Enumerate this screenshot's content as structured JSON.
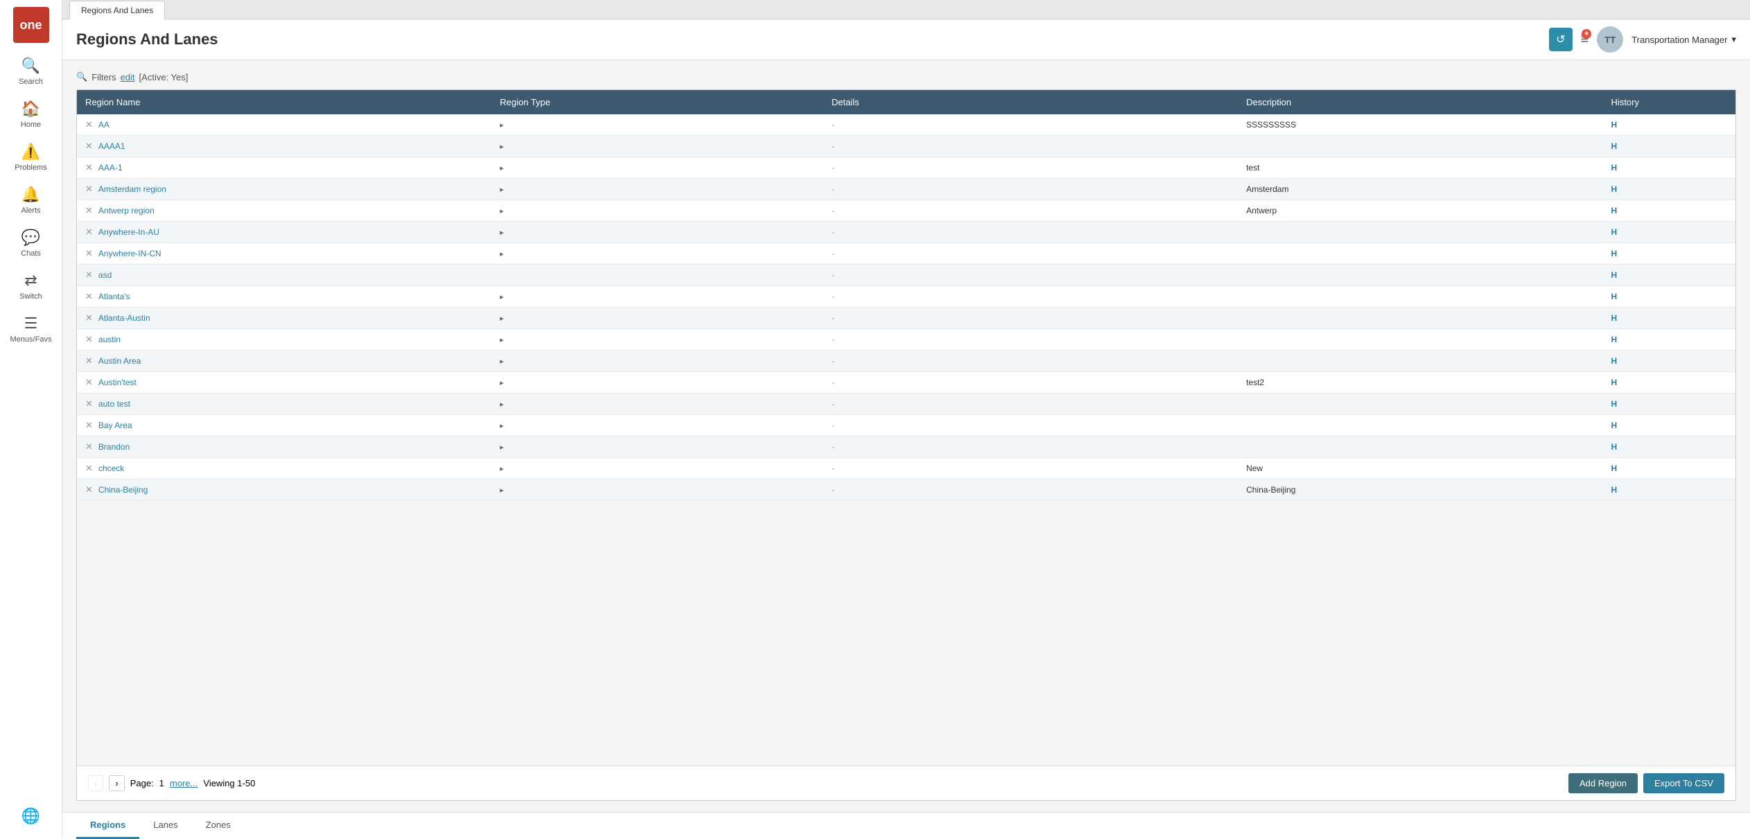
{
  "app": {
    "logo": "one",
    "tab": "Regions And Lanes"
  },
  "sidebar": {
    "items": [
      {
        "id": "search",
        "label": "Search",
        "icon": "🔍"
      },
      {
        "id": "home",
        "label": "Home",
        "icon": "🏠"
      },
      {
        "id": "problems",
        "label": "Problems",
        "icon": "⚠️"
      },
      {
        "id": "alerts",
        "label": "Alerts",
        "icon": "🔔"
      },
      {
        "id": "chats",
        "label": "Chats",
        "icon": "💬"
      },
      {
        "id": "switch",
        "label": "Switch",
        "icon": "⇄"
      },
      {
        "id": "menus-favs",
        "label": "Menus/Favs",
        "icon": "☰"
      }
    ],
    "globe_icon": "🌐"
  },
  "header": {
    "title": "Regions And Lanes",
    "refresh_icon": "↺",
    "menu_icon": "≡",
    "notification_count": "★",
    "avatar_initials": "TT",
    "user_role": "Transportation Manager",
    "dropdown_arrow": "▾"
  },
  "filters": {
    "label": "Filters",
    "edit_label": "edit",
    "active_filter": "[Active: Yes]"
  },
  "table": {
    "columns": [
      "Region Name",
      "Region Type",
      "Details",
      "Description",
      "History"
    ],
    "rows": [
      {
        "name": "AA",
        "type": "▸",
        "details": "-",
        "description": "SSSSSSSSS",
        "history": "H"
      },
      {
        "name": "AAAA1",
        "type": "▸",
        "details": "-",
        "description": "",
        "history": "H"
      },
      {
        "name": "AAA-1",
        "type": "▸",
        "details": "-",
        "description": "test",
        "history": "H"
      },
      {
        "name": "Amsterdam region",
        "type": "▸",
        "details": "-",
        "description": "Amsterdam",
        "history": "H"
      },
      {
        "name": "Antwerp region",
        "type": "▸",
        "details": "-",
        "description": "Antwerp",
        "history": "H"
      },
      {
        "name": "Anywhere-In-AU",
        "type": "▸",
        "details": "-",
        "description": "",
        "history": "H"
      },
      {
        "name": "Anywhere-IN-CN",
        "type": "▸",
        "details": "-",
        "description": "",
        "history": "H"
      },
      {
        "name": "asd",
        "type": "",
        "details": "-",
        "description": "",
        "history": "H"
      },
      {
        "name": "Atlanta's",
        "type": "▸",
        "details": "-",
        "description": "",
        "history": "H"
      },
      {
        "name": "Atlanta-Austin",
        "type": "▸",
        "details": "-",
        "description": "",
        "history": "H"
      },
      {
        "name": "austin",
        "type": "▸",
        "details": "-",
        "description": "",
        "history": "H"
      },
      {
        "name": "Austin Area",
        "type": "▸",
        "details": "-",
        "description": "",
        "history": "H"
      },
      {
        "name": "Austin'test",
        "type": "▸",
        "details": "-",
        "description": "test2",
        "history": "H"
      },
      {
        "name": "auto test",
        "type": "▸",
        "details": "-",
        "description": "",
        "history": "H"
      },
      {
        "name": "Bay Area",
        "type": "▸",
        "details": "-",
        "description": "",
        "history": "H"
      },
      {
        "name": "Brandon",
        "type": "▸",
        "details": "-",
        "description": "",
        "history": "H"
      },
      {
        "name": "chceck",
        "type": "▸",
        "details": "-",
        "description": "New",
        "history": "H"
      },
      {
        "name": "China-Beijing",
        "type": "▸",
        "details": "-",
        "description": "China-Beijing",
        "history": "H"
      }
    ]
  },
  "pagination": {
    "prev_btn": "‹",
    "next_btn": "›",
    "page_label": "Page:",
    "current_page": "1",
    "more_label": "more...",
    "viewing_label": "Viewing 1-50"
  },
  "action_buttons": {
    "add_region": "Add Region",
    "export_csv": "Export To CSV"
  },
  "bottom_tabs": [
    {
      "id": "regions",
      "label": "Regions",
      "active": true
    },
    {
      "id": "lanes",
      "label": "Lanes",
      "active": false
    },
    {
      "id": "zones",
      "label": "Zones",
      "active": false
    }
  ]
}
